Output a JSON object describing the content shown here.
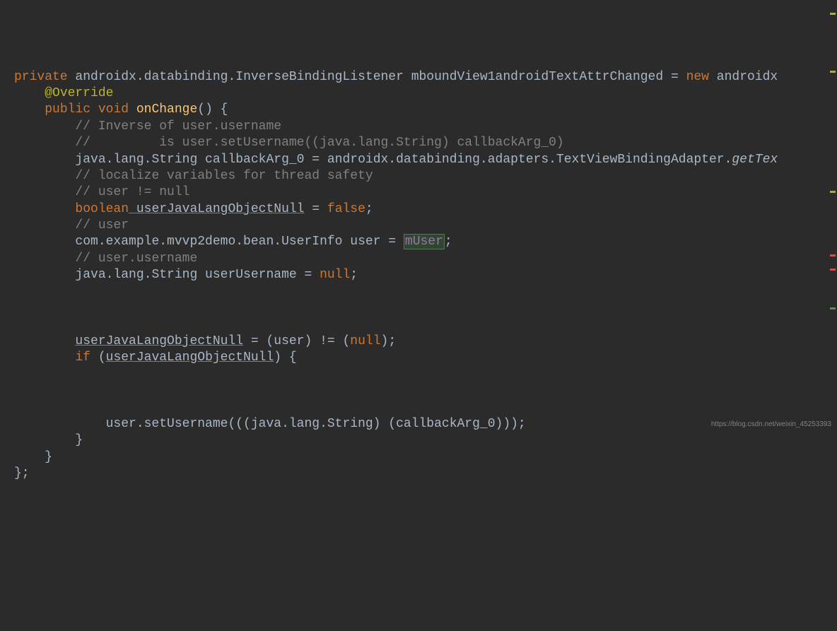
{
  "code": {
    "line1_private": "private",
    "line1_type": " androidx.databinding.InverseBindingListener mboundView1androidTextAttrChanged = ",
    "line1_new": "new",
    "line1_rest": " androidx",
    "line2_annotation": "@Override",
    "line3_public": "public",
    "line3_void": " void",
    "line3_method": " onChange",
    "line3_paren": "() {",
    "line4_comment": "// Inverse of user.username",
    "line5_comment": "//         is user.setUsername((java.lang.String) callbackArg_0)",
    "line6_a": "java.lang.String callbackArg_0 = androidx.databinding.adapters.TextViewBindingAdapter.",
    "line6_method": "getTex",
    "line7_comment": "// localize variables for thread safety",
    "line8_comment": "// user != null",
    "line9_boolean": "boolean",
    "line9_var": " userJavaLangObjectNull",
    "line9_eq": " = ",
    "line9_false": "false",
    "line9_semi": ";",
    "line10_comment": "// user",
    "line11_a": "com.example.mvvp2demo.bean.UserInfo user = ",
    "line11_field": "mUser",
    "line11_b": ";",
    "line12_comment": "// user.username",
    "line13_a": "java.lang.String userUsername = ",
    "line13_null": "null",
    "line13_b": ";",
    "line17_var": "userJavaLangObjectNull",
    "line17_a": " = (user) != (",
    "line17_null": "null",
    "line17_b": ");",
    "line18_if": "if",
    "line18_a": " (",
    "line18_var": "userJavaLangObjectNull",
    "line18_b": ") {",
    "line22": "user.setUsername(((java.lang.String) (callbackArg_0)));",
    "line23": "}",
    "line24": "}",
    "line25": "};",
    "indent1": "    ",
    "indent2": "        ",
    "indent3": "            "
  },
  "watermark": "https://blog.csdn.net/weixin_45253393"
}
